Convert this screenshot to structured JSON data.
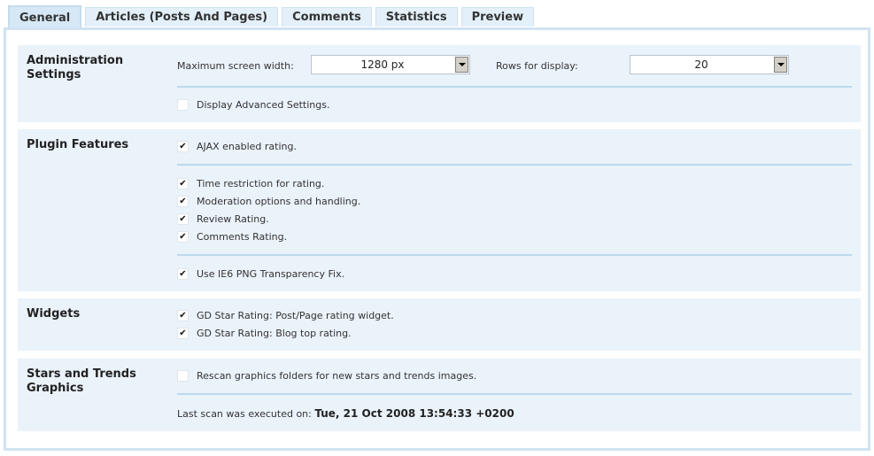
{
  "tabs": [
    {
      "label": "General",
      "active": true
    },
    {
      "label": "Articles (Posts And Pages)",
      "active": false
    },
    {
      "label": "Comments",
      "active": false
    },
    {
      "label": "Statistics",
      "active": false
    },
    {
      "label": "Preview",
      "active": false
    }
  ],
  "sections": {
    "admin": {
      "title": "Administration Settings",
      "max_width_label": "Maximum screen width:",
      "max_width_value": "1280 px",
      "rows_label": "Rows for display:",
      "rows_value": "20",
      "advanced_label": "Display Advanced Settings.",
      "advanced_checked": false
    },
    "plugin": {
      "title": "Plugin Features",
      "items": [
        {
          "label": "AJAX enabled rating.",
          "checked": true
        },
        {
          "label": "Time restriction for rating.",
          "checked": true
        },
        {
          "label": "Moderation options and handling.",
          "checked": true
        },
        {
          "label": "Review Rating.",
          "checked": true
        },
        {
          "label": "Comments Rating.",
          "checked": true
        },
        {
          "label": "Use IE6 PNG Transparency Fix.",
          "checked": true
        }
      ]
    },
    "widgets": {
      "title": "Widgets",
      "items": [
        {
          "label": "GD Star Rating: Post/Page rating widget.",
          "checked": true
        },
        {
          "label": "GD Star Rating: Blog top rating.",
          "checked": true
        }
      ]
    },
    "stars": {
      "title": "Stars and Trends Graphics",
      "rescan_label": "Rescan graphics folders for new stars and trends images.",
      "rescan_checked": false,
      "last_scan_label": "Last scan was executed on:",
      "last_scan_value": "Tue, 21 Oct 2008 13:54:33 +0200"
    }
  },
  "icons": {
    "check": "✔"
  },
  "colors": {
    "section_bg": "#eaf2fa",
    "divider": "#bcd9ec",
    "tab_bg": "#e3f0f9",
    "panel_border": "#d1e3f1"
  }
}
